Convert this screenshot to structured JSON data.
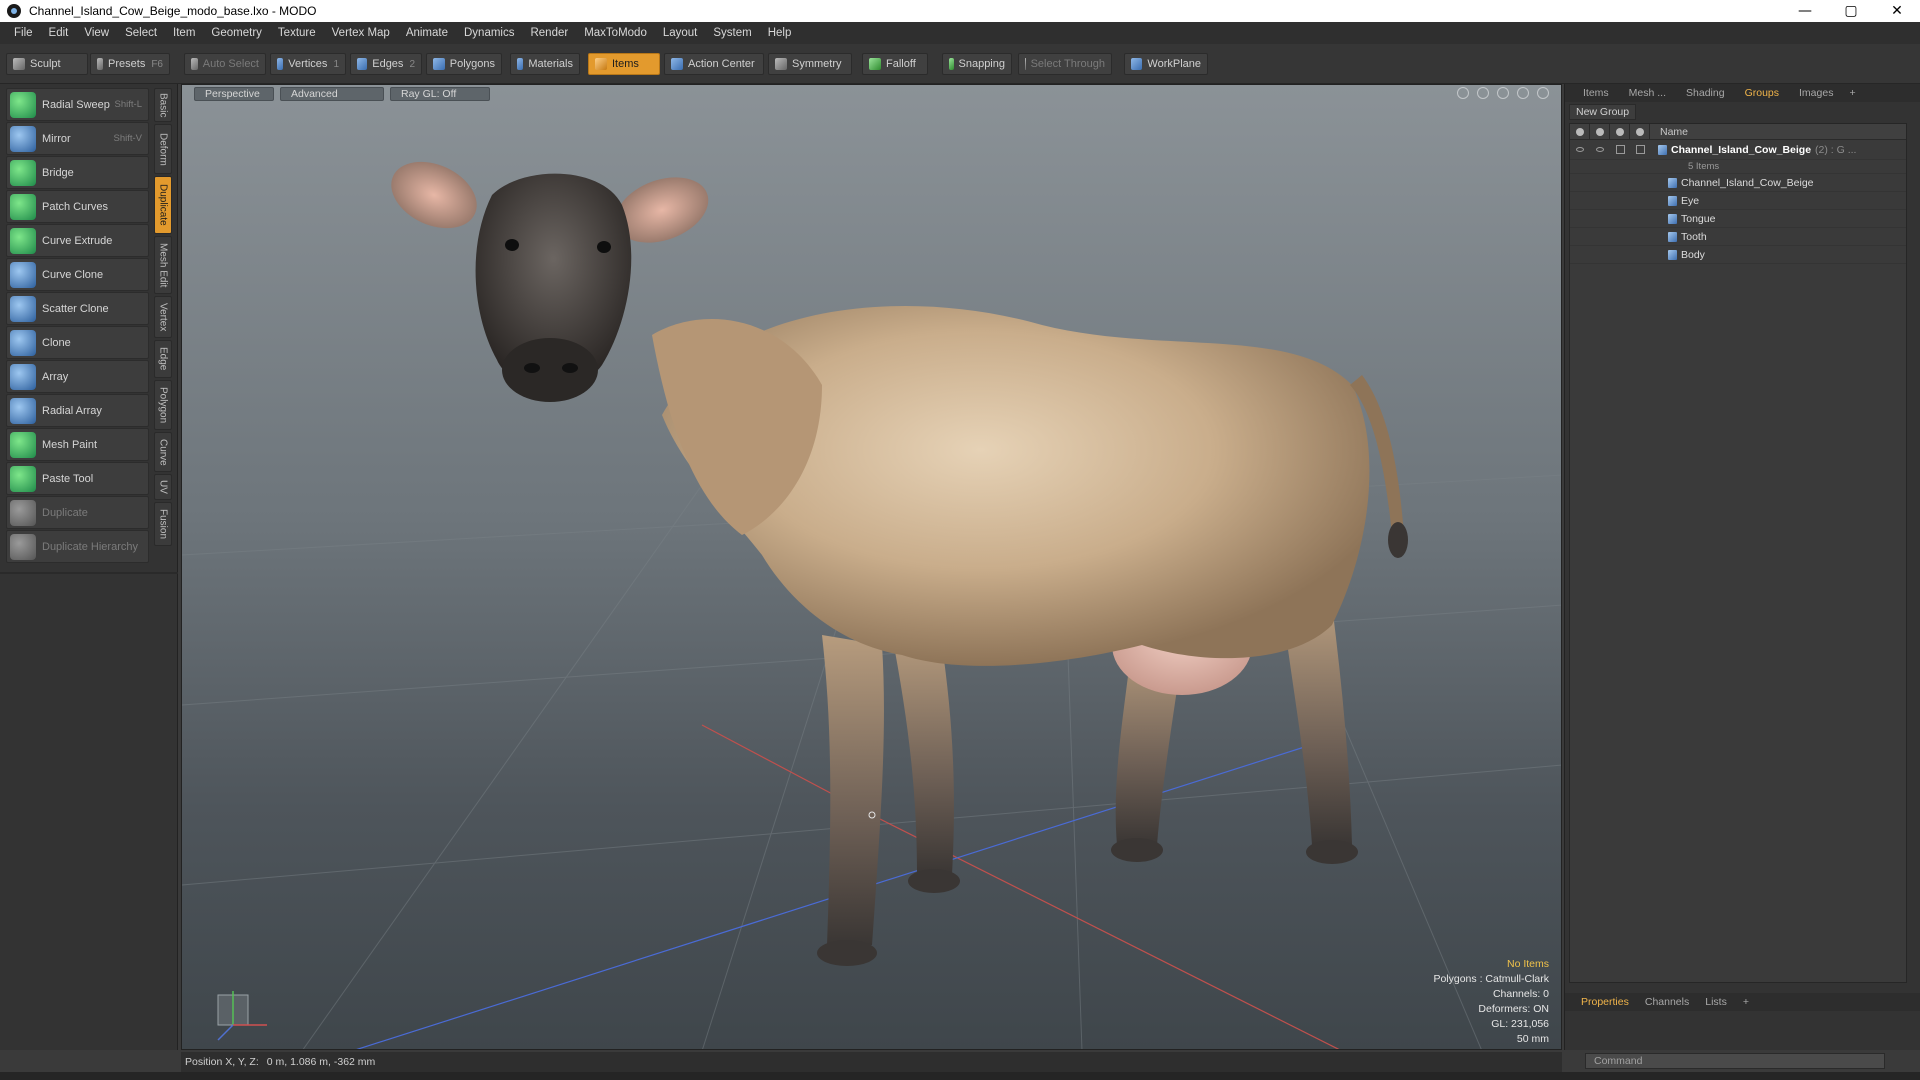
{
  "window": {
    "title": "Channel_Island_Cow_Beige_modo_base.lxo - MODO",
    "minimize": "—",
    "maximize": "▢",
    "close": "✕"
  },
  "menu": [
    "File",
    "Edit",
    "View",
    "Select",
    "Item",
    "Geometry",
    "Texture",
    "Vertex Map",
    "Animate",
    "Dynamics",
    "Render",
    "MaxToModo",
    "Layout",
    "System",
    "Help"
  ],
  "toolbar": {
    "sculpt": "Sculpt",
    "presets": "Presets",
    "presets_key": "F6",
    "auto_select": "Auto Select",
    "vertices": "Vertices",
    "vertices_count": "1",
    "edges": "Edges",
    "edges_count": "2",
    "polygons": "Polygons",
    "materials": "Materials",
    "items": "Items",
    "action_center": "Action Center",
    "symmetry": "Symmetry",
    "falloff": "Falloff",
    "snapping": "Snapping",
    "select_through": "Select Through",
    "workplane": "WorkPlane"
  },
  "tools": [
    {
      "label": "Radial Sweep",
      "key": "Shift-L",
      "icon": "radial-sweep-icon"
    },
    {
      "label": "Mirror",
      "key": "Shift-V",
      "icon": "mirror-icon"
    },
    {
      "label": "Bridge",
      "key": "",
      "icon": "bridge-icon"
    },
    {
      "label": "Patch Curves",
      "key": "",
      "icon": "patch-curves-icon"
    },
    {
      "label": "Curve Extrude",
      "key": "",
      "icon": "curve-extrude-icon"
    },
    {
      "label": "Curve Clone",
      "key": "",
      "icon": "curve-clone-icon"
    },
    {
      "label": "Scatter Clone",
      "key": "",
      "icon": "scatter-clone-icon"
    },
    {
      "label": "Clone",
      "key": "",
      "icon": "clone-icon"
    },
    {
      "label": "Array",
      "key": "",
      "icon": "array-icon"
    },
    {
      "label": "Radial Array",
      "key": "",
      "icon": "radial-array-icon"
    },
    {
      "label": "Mesh Paint",
      "key": "",
      "icon": "mesh-paint-icon"
    },
    {
      "label": "Paste Tool",
      "key": "",
      "icon": "paste-tool-icon"
    },
    {
      "label": "Duplicate",
      "key": "",
      "icon": "duplicate-icon"
    },
    {
      "label": "Duplicate Hierarchy",
      "key": "",
      "icon": "duplicate-hierarchy-icon"
    }
  ],
  "vtabs": [
    "Basic",
    "Deform",
    "Duplicate",
    "Mesh Edit",
    "Vertex",
    "Edge",
    "Polygon",
    "Curve",
    "UV",
    "Fusion"
  ],
  "viewport": {
    "view": "Perspective",
    "shading": "Advanced",
    "raygl": "Ray GL: Off",
    "info_title": "No Items",
    "info_polygons": "Polygons : Catmull-Clark",
    "info_channels": "Channels: 0",
    "info_deformers": "Deformers: ON",
    "info_gl": "GL: 231,056",
    "info_scale": "50 mm"
  },
  "right_tabs": [
    "Items",
    "Mesh ...",
    "Shading",
    "Groups",
    "Images",
    "+"
  ],
  "groups": {
    "new_group": "New Group",
    "name_header": "Name",
    "group_name": "Channel_Island_Cow_Beige",
    "group_count": "(2) : G ...",
    "group_sub": "5 Items",
    "items": [
      "Channel_Island_Cow_Beige",
      "Eye",
      "Tongue",
      "Tooth",
      "Body"
    ]
  },
  "bottom_tabs": [
    "Properties",
    "Channels",
    "Lists",
    "+"
  ],
  "command_placeholder": "Command",
  "status": {
    "label": "Position X, Y, Z:",
    "value": "0 m, 1.086 m, -362 mm"
  },
  "colors": {
    "accent": "#e39a2d",
    "active_tab": "#f0b44a"
  }
}
